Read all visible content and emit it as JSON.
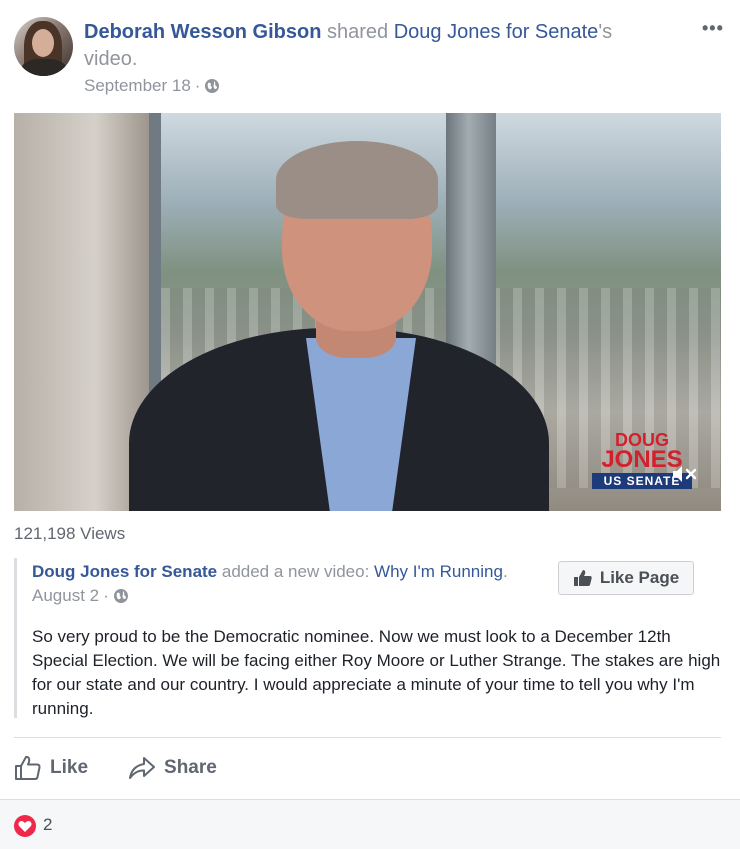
{
  "post": {
    "author": "Deborah Wesson Gibson",
    "action_text": " shared ",
    "page_name": "Doug Jones for Senate",
    "video_suffix": "'s video.",
    "date": "September 18",
    "dot": " · ",
    "more_label": "•••"
  },
  "video": {
    "logo_line1": "DOUG",
    "logo_line2": "JONES",
    "logo_line3": "US SENATE",
    "views": "121,198 Views"
  },
  "shared": {
    "page_name": "Doug Jones for Senate",
    "action_text": " added a new video: ",
    "video_title": "Why I'm Running",
    "period": ".",
    "date": "August 2",
    "dot": " · ",
    "like_page_label": "Like Page",
    "body": "So very proud to be the Democratic nominee. Now we must look to a December 12th Special Election. We will be facing either Roy Moore or Luther Strange. The stakes are high for our state and our country. I would appreciate a minute of your time to tell you why I'm running."
  },
  "actions": {
    "like_label": "Like",
    "share_label": "Share"
  },
  "reactions": {
    "count": "2",
    "type": "love",
    "color": "#f0284a"
  },
  "colors": {
    "link": "#365899",
    "meta": "#90949c"
  }
}
